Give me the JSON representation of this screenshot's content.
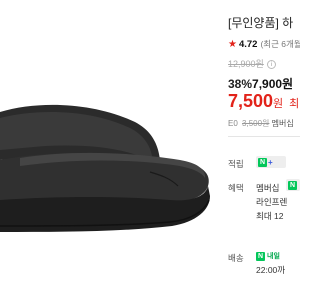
{
  "product": {
    "title": "[무인양품] 하",
    "image_alt": "black slide sandal"
  },
  "rating": {
    "value": "4.72",
    "recent": "(최근 6개월"
  },
  "price": {
    "original": "12,900원",
    "discount_pct": "38%",
    "discounted": "7,900원",
    "final": "7,500",
    "final_won": "원",
    "final_extra": "최"
  },
  "coupon": {
    "prefix": "E0",
    "strike": "3,500원",
    "text": "멤버십"
  },
  "benefits": {
    "points_label": "적립",
    "benefit_label": "혜택",
    "benefit_line1": "멤버십 ",
    "benefit_line2": "라인프렌",
    "benefit_line3": "최대 12",
    "delivery_label": "배송",
    "delivery_badge": "내일",
    "delivery_time": "22:00까"
  },
  "colors": {
    "accent_red": "#e2231a",
    "naver_green": "#03c75a"
  }
}
